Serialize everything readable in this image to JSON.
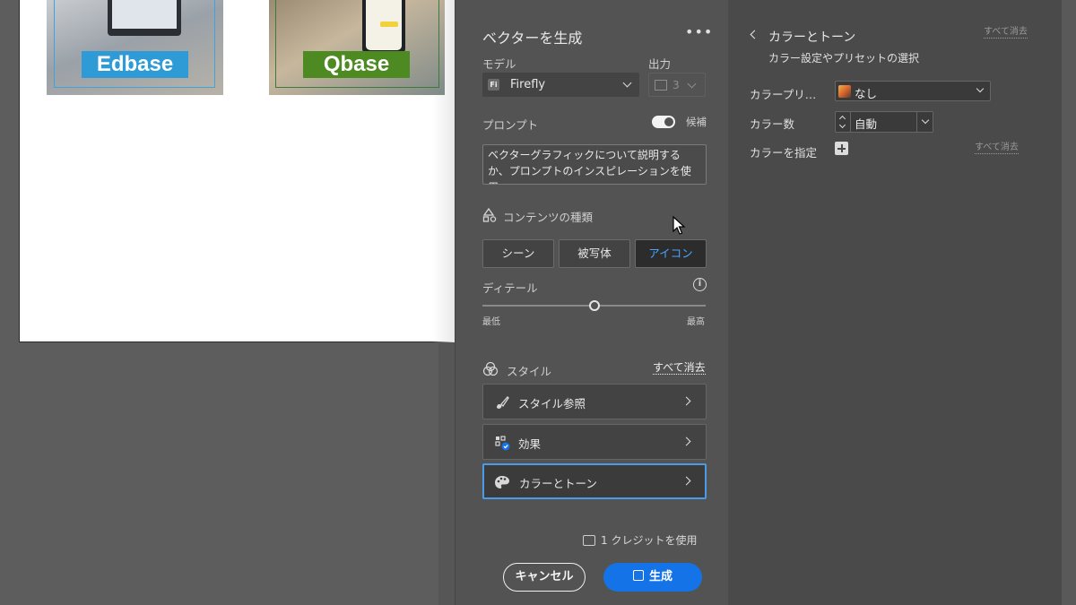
{
  "canvas": {
    "thumbnails": [
      {
        "brand": "Edbase",
        "brand_color": "#2e9ad6"
      },
      {
        "brand": "Qbase",
        "brand_color": "#4e8a22"
      }
    ]
  },
  "generate_panel": {
    "title": "ベクターを生成",
    "more_icon": "•••",
    "model_label": "モデル",
    "model_badge": "Fi",
    "model_value": "Firefly",
    "output_label": "出力",
    "output_value": "3",
    "prompt_label": "プロンプト",
    "suggest_toggle_label": "候補",
    "prompt_placeholder": "ベクターグラフィックについて説明するか、プロンプトのインスピレーションを使用",
    "content_type_label": "コンテンツの種類",
    "content_types": [
      "シーン",
      "被写体",
      "アイコン"
    ],
    "content_type_selected": "アイコン",
    "detail_label": "ディテール",
    "detail_info_icon": "i",
    "detail_min": "最低",
    "detail_max": "最高",
    "detail_level": 0.5,
    "style_label": "スタイル",
    "style_clear": "すべて消去",
    "style_rows": [
      {
        "label": "スタイル参照",
        "icon": "brush-icon"
      },
      {
        "label": "効果",
        "icon": "effects-icon"
      },
      {
        "label": "カラーとトーン",
        "icon": "palette-icon"
      }
    ],
    "credits": "1 クレジットを使用",
    "cancel_label": "キャンセル",
    "generate_label": "生成",
    "accent_color": "#1473e6"
  },
  "color_panel": {
    "title": "カラーとトーン",
    "subtitle": "カラー設定やプリセットの選択",
    "clear_all_top": "すべて消去",
    "preset_label": "カラープリ…",
    "preset_value": "なし",
    "count_label": "カラー数",
    "count_value": "自動",
    "specify_label": "カラーを指定",
    "clear_all_specify": "すべて消去"
  }
}
